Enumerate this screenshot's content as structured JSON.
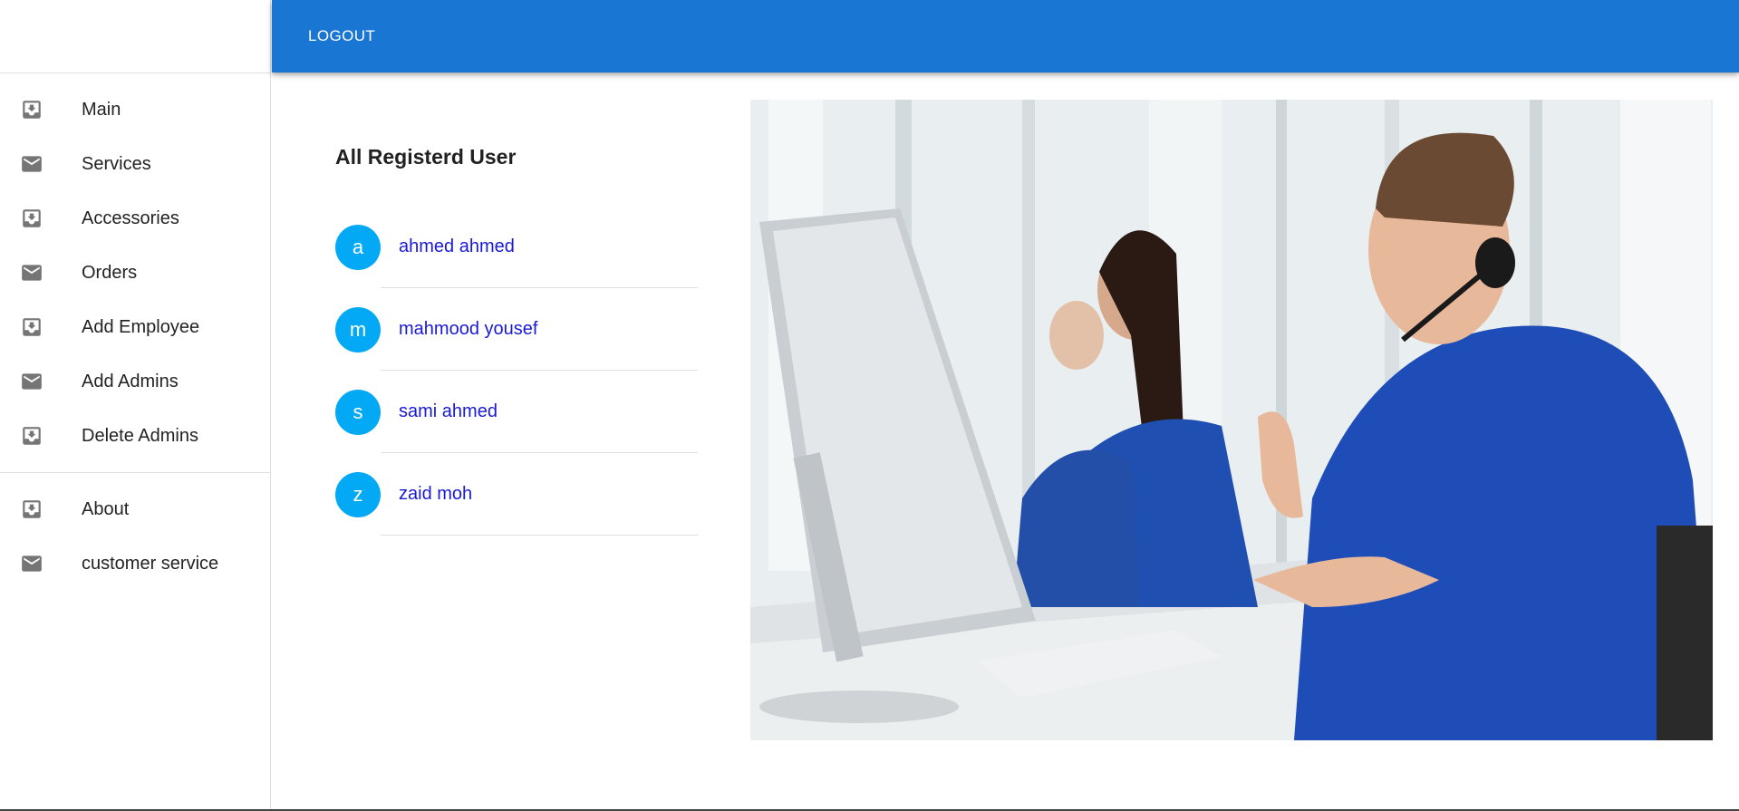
{
  "appbar": {
    "logout_label": "LOGOUT"
  },
  "sidebar": {
    "group1": [
      {
        "label": "Main",
        "icon": "move-to-inbox-icon"
      },
      {
        "label": "Services",
        "icon": "mail-icon"
      },
      {
        "label": "Accessories",
        "icon": "move-to-inbox-icon"
      },
      {
        "label": "Orders",
        "icon": "mail-icon"
      },
      {
        "label": "Add Employee",
        "icon": "move-to-inbox-icon"
      },
      {
        "label": "Add Admins",
        "icon": "mail-icon"
      },
      {
        "label": "Delete Admins",
        "icon": "move-to-inbox-icon"
      }
    ],
    "group2": [
      {
        "label": "About",
        "icon": "move-to-inbox-icon"
      },
      {
        "label": "customer service",
        "icon": "mail-icon"
      }
    ]
  },
  "users": {
    "title": "All Registerd User",
    "list": [
      {
        "initial": "a",
        "name": "ahmed ahmed"
      },
      {
        "initial": "m",
        "name": "mahmood yousef"
      },
      {
        "initial": "s",
        "name": "sami ahmed"
      },
      {
        "initial": "z",
        "name": "zaid moh"
      }
    ]
  },
  "colors": {
    "appbar": "#1976d2",
    "avatar": "#03a9f4",
    "user_link": "#1a1ad6"
  }
}
